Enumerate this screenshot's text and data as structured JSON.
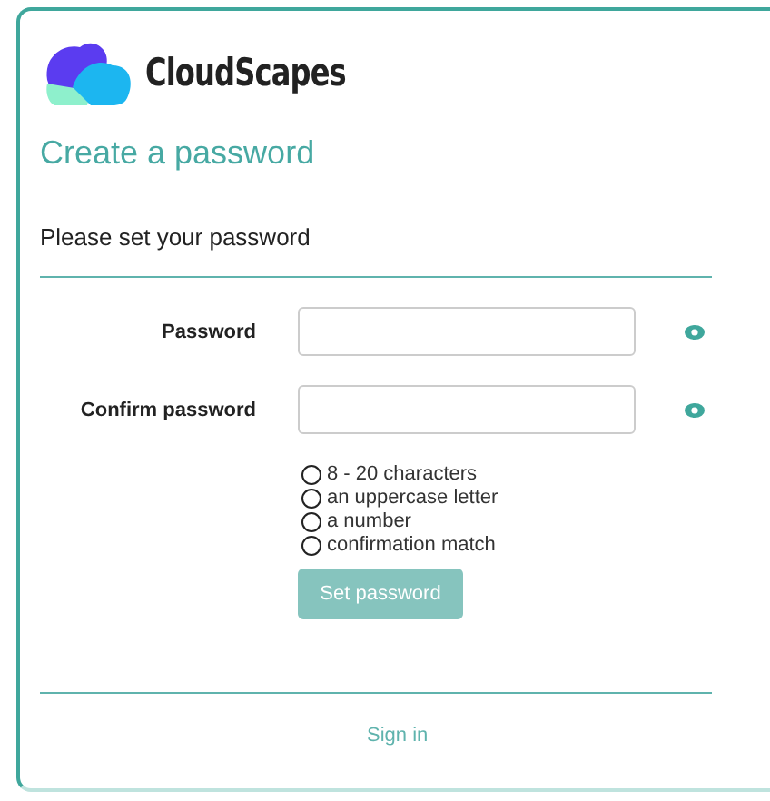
{
  "brand": {
    "name": "CloudScapes"
  },
  "title": "Create a password",
  "subtitle": "Please set your password",
  "fields": [
    {
      "label": "Password"
    },
    {
      "label": "Confirm password"
    }
  ],
  "requirements": [
    {
      "text": "8 - 20 characters",
      "met": false
    },
    {
      "text": "an uppercase letter",
      "met": false
    },
    {
      "text": "a number",
      "met": false
    },
    {
      "text": "confirmation match",
      "met": false
    }
  ],
  "submit": {
    "label": "Set password",
    "disabled": true
  },
  "footer_link": "Sign in"
}
